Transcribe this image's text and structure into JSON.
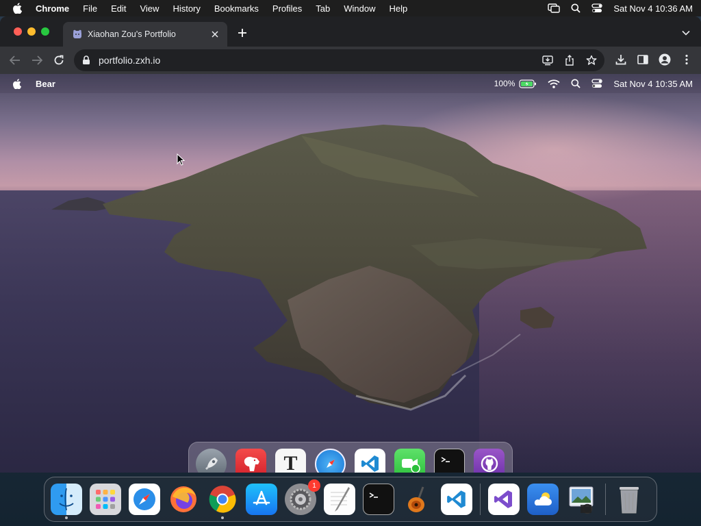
{
  "host_menubar": {
    "app_name": "Chrome",
    "menus": [
      "File",
      "Edit",
      "View",
      "History",
      "Bookmarks",
      "Profiles",
      "Tab",
      "Window",
      "Help"
    ],
    "datetime": "Sat Nov 4  10:36 AM"
  },
  "browser": {
    "tab_title": "Xiaohan Zou's Portfolio",
    "url": "portfolio.zxh.io"
  },
  "inner_desktop": {
    "app_name": "Bear",
    "battery": "100%",
    "datetime": "Sat Nov 4 10:35 AM",
    "dock_icons": [
      "launchpad-icon",
      "bear-icon",
      "typora-icon",
      "safari-icon",
      "vscode-icon",
      "facetime-icon",
      "terminal-icon",
      "github-icon"
    ]
  },
  "host_dock": {
    "icons": [
      "finder-icon",
      "launchpad-icon",
      "safari-icon",
      "firefox-icon",
      "chrome-icon",
      "app-store-icon",
      "system-preferences-icon",
      "textedit-icon",
      "terminal-icon",
      "garageband-icon",
      "vscode-icon",
      "visual-studio-icon",
      "weather-icon",
      "preview-icon",
      "trash-icon"
    ],
    "system_preferences_badge": "1"
  },
  "colors": {
    "chrome_bg": "#202124",
    "chrome_toolbar": "#35363a",
    "accent_red": "#ff5f57",
    "accent_yellow": "#febc2e",
    "accent_green": "#28c840"
  }
}
